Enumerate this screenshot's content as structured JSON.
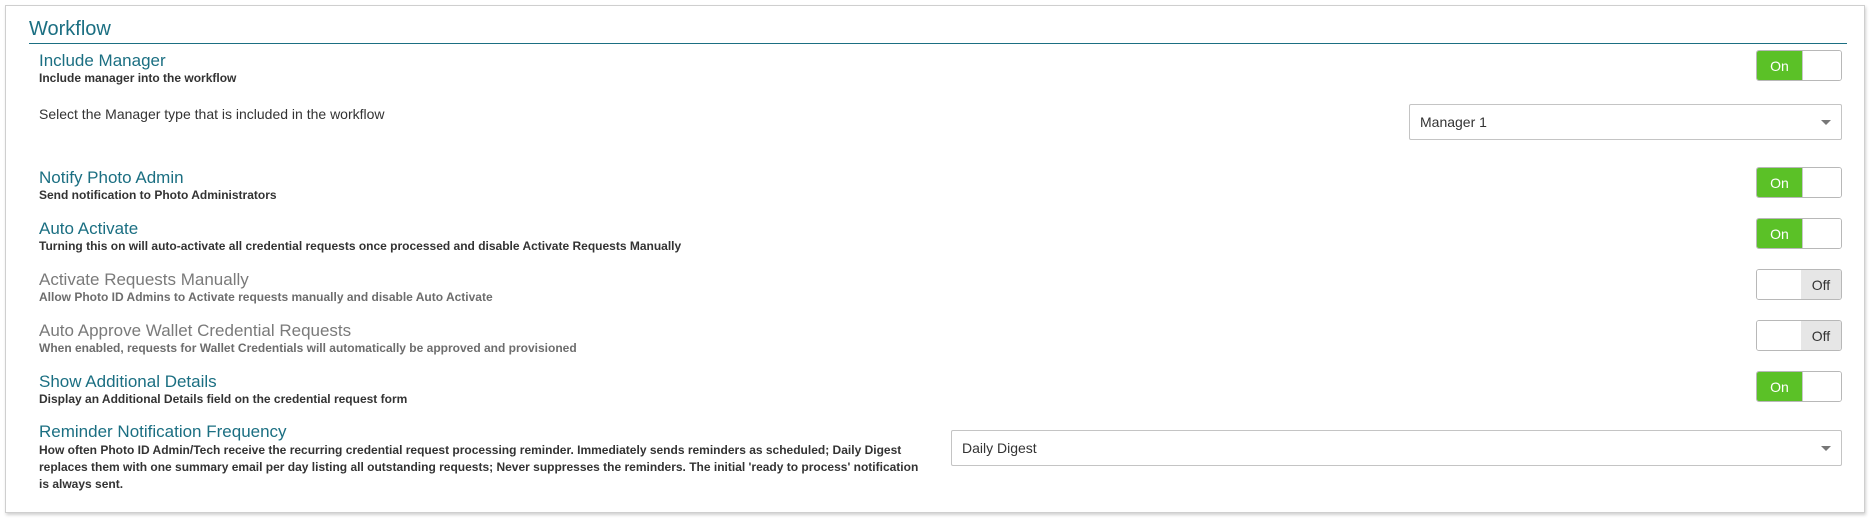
{
  "section": {
    "title": "Workflow"
  },
  "settings": {
    "include_manager": {
      "title": "Include Manager",
      "description": "Include manager into the workflow",
      "toggle": "On"
    },
    "manager_type": {
      "label": "Select the Manager type that is included in the workflow",
      "selected": "Manager 1"
    },
    "notify_photo_admin": {
      "title": "Notify Photo Admin",
      "description": "Send notification to Photo Administrators",
      "toggle": "On"
    },
    "auto_activate": {
      "title": "Auto Activate",
      "description": "Turning this on will auto-activate all credential requests once processed and disable Activate Requests Manually",
      "toggle": "On"
    },
    "activate_manually": {
      "title": "Activate Requests Manually",
      "description": "Allow Photo ID Admins to Activate requests manually and disable Auto Activate",
      "toggle": "Off"
    },
    "auto_approve_wallet": {
      "title": "Auto Approve Wallet Credential Requests",
      "description": "When enabled, requests for Wallet Credentials will automatically be approved and provisioned",
      "toggle": "Off"
    },
    "show_additional_details": {
      "title": "Show Additional Details",
      "description": "Display an Additional Details field on the credential request form",
      "toggle": "On"
    },
    "reminder_frequency": {
      "title": "Reminder Notification Frequency",
      "description": "How often Photo ID Admin/Tech receive the recurring credential request processing reminder. Immediately sends reminders as scheduled; Daily Digest replaces them with one summary email per day listing all outstanding requests; Never suppresses the reminders. The initial 'ready to process' notification is always sent.",
      "selected": "Daily Digest"
    }
  },
  "colors": {
    "accent": "#1b6f82",
    "toggle_on": "#5bc127",
    "toggle_off": "#e6e6e6",
    "muted_text": "#7a7a7a"
  },
  "icons": {
    "dropdown": "chevron-down-icon"
  }
}
